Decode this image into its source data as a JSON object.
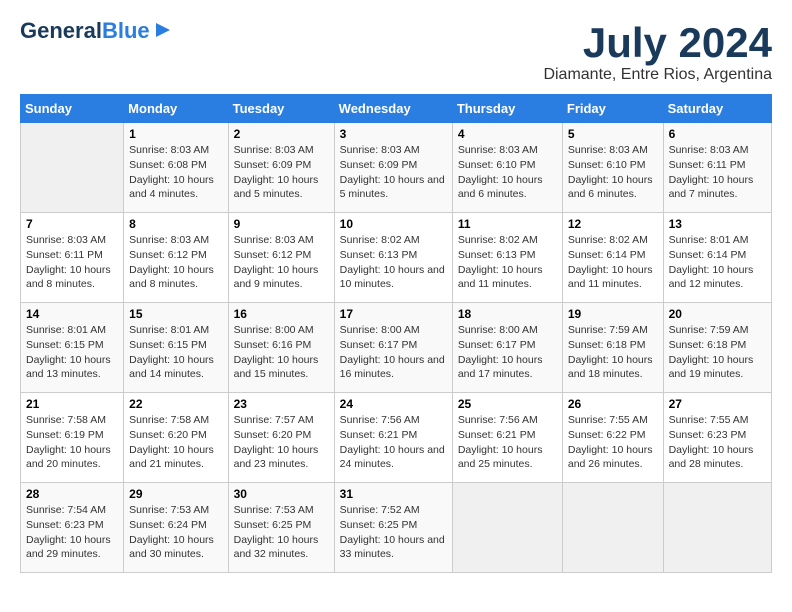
{
  "header": {
    "logo_line1": "General",
    "logo_line2": "Blue",
    "month_title": "July 2024",
    "location": "Diamante, Entre Rios, Argentina"
  },
  "weekdays": [
    "Sunday",
    "Monday",
    "Tuesday",
    "Wednesday",
    "Thursday",
    "Friday",
    "Saturday"
  ],
  "weeks": [
    [
      {
        "day": "",
        "sunrise": "",
        "sunset": "",
        "daylight": ""
      },
      {
        "day": "1",
        "sunrise": "Sunrise: 8:03 AM",
        "sunset": "Sunset: 6:08 PM",
        "daylight": "Daylight: 10 hours and 4 minutes."
      },
      {
        "day": "2",
        "sunrise": "Sunrise: 8:03 AM",
        "sunset": "Sunset: 6:09 PM",
        "daylight": "Daylight: 10 hours and 5 minutes."
      },
      {
        "day": "3",
        "sunrise": "Sunrise: 8:03 AM",
        "sunset": "Sunset: 6:09 PM",
        "daylight": "Daylight: 10 hours and 5 minutes."
      },
      {
        "day": "4",
        "sunrise": "Sunrise: 8:03 AM",
        "sunset": "Sunset: 6:10 PM",
        "daylight": "Daylight: 10 hours and 6 minutes."
      },
      {
        "day": "5",
        "sunrise": "Sunrise: 8:03 AM",
        "sunset": "Sunset: 6:10 PM",
        "daylight": "Daylight: 10 hours and 6 minutes."
      },
      {
        "day": "6",
        "sunrise": "Sunrise: 8:03 AM",
        "sunset": "Sunset: 6:11 PM",
        "daylight": "Daylight: 10 hours and 7 minutes."
      }
    ],
    [
      {
        "day": "7",
        "sunrise": "Sunrise: 8:03 AM",
        "sunset": "Sunset: 6:11 PM",
        "daylight": "Daylight: 10 hours and 8 minutes."
      },
      {
        "day": "8",
        "sunrise": "Sunrise: 8:03 AM",
        "sunset": "Sunset: 6:12 PM",
        "daylight": "Daylight: 10 hours and 8 minutes."
      },
      {
        "day": "9",
        "sunrise": "Sunrise: 8:03 AM",
        "sunset": "Sunset: 6:12 PM",
        "daylight": "Daylight: 10 hours and 9 minutes."
      },
      {
        "day": "10",
        "sunrise": "Sunrise: 8:02 AM",
        "sunset": "Sunset: 6:13 PM",
        "daylight": "Daylight: 10 hours and 10 minutes."
      },
      {
        "day": "11",
        "sunrise": "Sunrise: 8:02 AM",
        "sunset": "Sunset: 6:13 PM",
        "daylight": "Daylight: 10 hours and 11 minutes."
      },
      {
        "day": "12",
        "sunrise": "Sunrise: 8:02 AM",
        "sunset": "Sunset: 6:14 PM",
        "daylight": "Daylight: 10 hours and 11 minutes."
      },
      {
        "day": "13",
        "sunrise": "Sunrise: 8:01 AM",
        "sunset": "Sunset: 6:14 PM",
        "daylight": "Daylight: 10 hours and 12 minutes."
      }
    ],
    [
      {
        "day": "14",
        "sunrise": "Sunrise: 8:01 AM",
        "sunset": "Sunset: 6:15 PM",
        "daylight": "Daylight: 10 hours and 13 minutes."
      },
      {
        "day": "15",
        "sunrise": "Sunrise: 8:01 AM",
        "sunset": "Sunset: 6:15 PM",
        "daylight": "Daylight: 10 hours and 14 minutes."
      },
      {
        "day": "16",
        "sunrise": "Sunrise: 8:00 AM",
        "sunset": "Sunset: 6:16 PM",
        "daylight": "Daylight: 10 hours and 15 minutes."
      },
      {
        "day": "17",
        "sunrise": "Sunrise: 8:00 AM",
        "sunset": "Sunset: 6:17 PM",
        "daylight": "Daylight: 10 hours and 16 minutes."
      },
      {
        "day": "18",
        "sunrise": "Sunrise: 8:00 AM",
        "sunset": "Sunset: 6:17 PM",
        "daylight": "Daylight: 10 hours and 17 minutes."
      },
      {
        "day": "19",
        "sunrise": "Sunrise: 7:59 AM",
        "sunset": "Sunset: 6:18 PM",
        "daylight": "Daylight: 10 hours and 18 minutes."
      },
      {
        "day": "20",
        "sunrise": "Sunrise: 7:59 AM",
        "sunset": "Sunset: 6:18 PM",
        "daylight": "Daylight: 10 hours and 19 minutes."
      }
    ],
    [
      {
        "day": "21",
        "sunrise": "Sunrise: 7:58 AM",
        "sunset": "Sunset: 6:19 PM",
        "daylight": "Daylight: 10 hours and 20 minutes."
      },
      {
        "day": "22",
        "sunrise": "Sunrise: 7:58 AM",
        "sunset": "Sunset: 6:20 PM",
        "daylight": "Daylight: 10 hours and 21 minutes."
      },
      {
        "day": "23",
        "sunrise": "Sunrise: 7:57 AM",
        "sunset": "Sunset: 6:20 PM",
        "daylight": "Daylight: 10 hours and 23 minutes."
      },
      {
        "day": "24",
        "sunrise": "Sunrise: 7:56 AM",
        "sunset": "Sunset: 6:21 PM",
        "daylight": "Daylight: 10 hours and 24 minutes."
      },
      {
        "day": "25",
        "sunrise": "Sunrise: 7:56 AM",
        "sunset": "Sunset: 6:21 PM",
        "daylight": "Daylight: 10 hours and 25 minutes."
      },
      {
        "day": "26",
        "sunrise": "Sunrise: 7:55 AM",
        "sunset": "Sunset: 6:22 PM",
        "daylight": "Daylight: 10 hours and 26 minutes."
      },
      {
        "day": "27",
        "sunrise": "Sunrise: 7:55 AM",
        "sunset": "Sunset: 6:23 PM",
        "daylight": "Daylight: 10 hours and 28 minutes."
      }
    ],
    [
      {
        "day": "28",
        "sunrise": "Sunrise: 7:54 AM",
        "sunset": "Sunset: 6:23 PM",
        "daylight": "Daylight: 10 hours and 29 minutes."
      },
      {
        "day": "29",
        "sunrise": "Sunrise: 7:53 AM",
        "sunset": "Sunset: 6:24 PM",
        "daylight": "Daylight: 10 hours and 30 minutes."
      },
      {
        "day": "30",
        "sunrise": "Sunrise: 7:53 AM",
        "sunset": "Sunset: 6:25 PM",
        "daylight": "Daylight: 10 hours and 32 minutes."
      },
      {
        "day": "31",
        "sunrise": "Sunrise: 7:52 AM",
        "sunset": "Sunset: 6:25 PM",
        "daylight": "Daylight: 10 hours and 33 minutes."
      },
      {
        "day": "",
        "sunrise": "",
        "sunset": "",
        "daylight": ""
      },
      {
        "day": "",
        "sunrise": "",
        "sunset": "",
        "daylight": ""
      },
      {
        "day": "",
        "sunrise": "",
        "sunset": "",
        "daylight": ""
      }
    ]
  ]
}
